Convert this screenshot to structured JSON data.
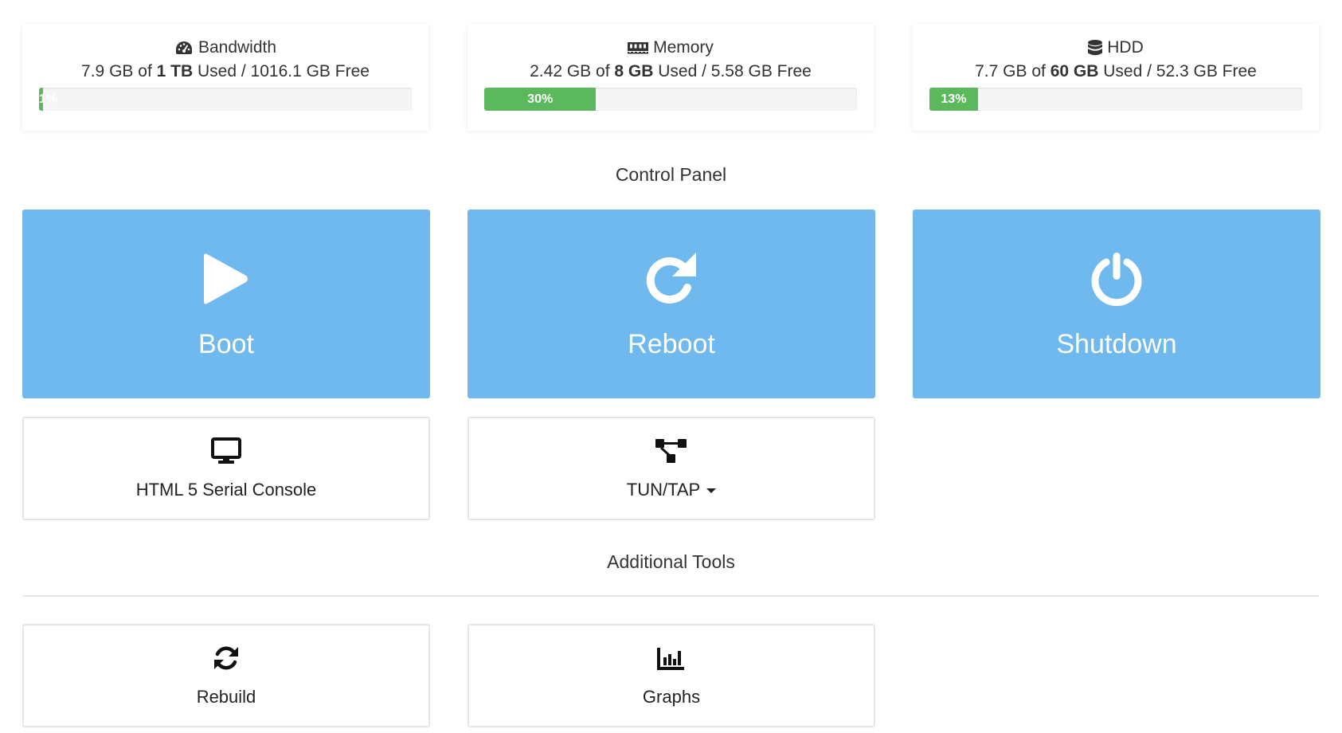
{
  "stats": [
    {
      "title": "Bandwidth",
      "icon": "gauge-icon",
      "used_value": "7.9 GB",
      "of_text": "of",
      "total": "1 TB",
      "used_label": "Used /",
      "free": "1016.1 GB Free",
      "percent_label": "1%",
      "fraction": 0.01
    },
    {
      "title": "Memory",
      "icon": "memory-icon",
      "used_value": "2.42 GB",
      "of_text": "of",
      "total": "8 GB",
      "used_label": "Used /",
      "free": "5.58 GB Free",
      "percent_label": "30%",
      "fraction": 0.3
    },
    {
      "title": "HDD",
      "icon": "database-icon",
      "used_value": "7.7 GB",
      "of_text": "of",
      "total": "60 GB",
      "used_label": "Used /",
      "free": "52.3 GB Free",
      "percent_label": "13%",
      "fraction": 0.13
    }
  ],
  "control_panel": {
    "title": "Control Panel",
    "boot_label": "Boot",
    "reboot_label": "Reboot",
    "shutdown_label": "Shutdown",
    "console_label": "HTML 5 Serial Console",
    "tuntap_label": "TUN/TAP"
  },
  "additional_tools": {
    "title": "Additional Tools",
    "rebuild_label": "Rebuild",
    "graphs_label": "Graphs"
  },
  "colors": {
    "primary_button": "#6fb9ee",
    "progress_fill": "#5cb85c",
    "progress_track": "#f5f5f5"
  }
}
